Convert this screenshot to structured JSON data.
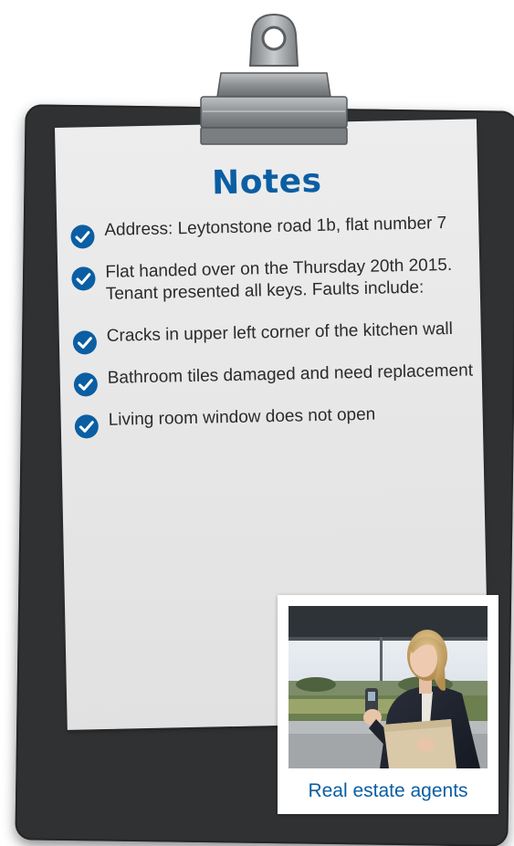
{
  "notes": {
    "title": "Notes",
    "items": [
      "Address: Leytonstone road 1b, flat number 7",
      "Flat handed over on the Thursday 20th 2015. Tenant presented all keys. Faults include:",
      "Cracks in upper left corner of the kitchen wall",
      "Bathroom tiles damaged and need replacement",
      "Living room window does not open"
    ]
  },
  "photo_card": {
    "caption": "Real estate agents",
    "image": "woman-holding-dictation-device-photo"
  },
  "icons": {
    "item_bullet": "check-circle-icon",
    "clip": "clipboard-clip-icon"
  },
  "colors": {
    "accent": "#0b5ea3",
    "board": "#2f3133",
    "paper": "#e8e8e8",
    "text": "#2b2b2b"
  }
}
